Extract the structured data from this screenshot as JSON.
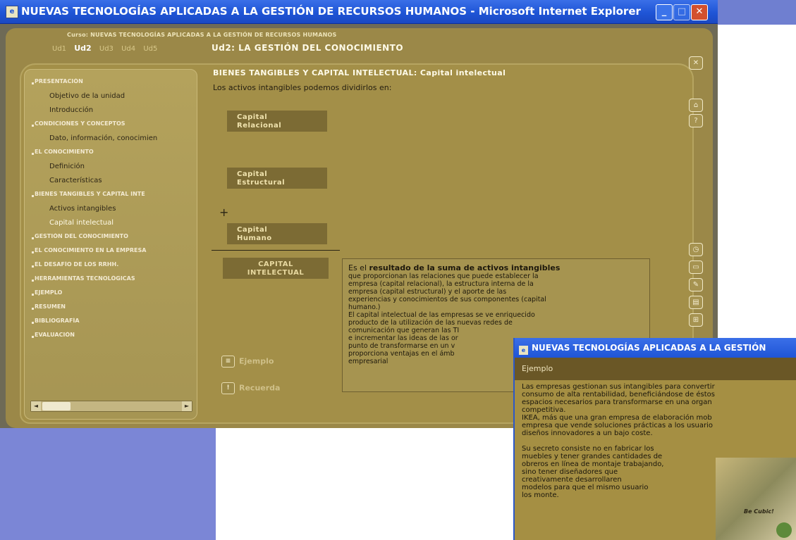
{
  "window": {
    "title": "NUEVAS TECNOLOGÍAS APLICADAS A LA GESTIÓN DE RECURSOS HUMANOS - Microsoft Internet Explorer",
    "min_glyph": "_",
    "max_glyph": "□",
    "close_glyph": "✕"
  },
  "header": {
    "course": "Curso: NUEVAS TECNOLOGÍAS APLICADAS A LA GESTIÓN DE RECURSOS HUMANOS",
    "unit_tabs": [
      "Ud1",
      "Ud2",
      "Ud3",
      "Ud4",
      "Ud5"
    ],
    "unit_title": "Ud2: LA GESTIÓN DEL CONOCIMIENTO"
  },
  "sidebar": {
    "items": [
      {
        "label": "PRESENTACIÓN",
        "kind": "section"
      },
      {
        "label": "Objetivo de la unidad",
        "kind": "sub"
      },
      {
        "label": "Introducción",
        "kind": "sub"
      },
      {
        "label": "CONDICIONES Y CONCEPTOS",
        "kind": "section"
      },
      {
        "label": "Dato, información, conocimien",
        "kind": "sub"
      },
      {
        "label": "EL CONOCIMIENTO",
        "kind": "section"
      },
      {
        "label": "Definición",
        "kind": "sub"
      },
      {
        "label": "Características",
        "kind": "sub"
      },
      {
        "label": "BIENES TANGIBLES Y CAPITAL INTE",
        "kind": "section"
      },
      {
        "label": "Activos intangibles",
        "kind": "sub"
      },
      {
        "label": "Capital intelectual",
        "kind": "sub"
      },
      {
        "label": "GESTIÓN DEL CONOCIMIENTO",
        "kind": "section"
      },
      {
        "label": "EL CONOCIMIENTO EN LA EMPRESA",
        "kind": "section"
      },
      {
        "label": "EL DESAFÍO DE LOS RRHH.",
        "kind": "section"
      },
      {
        "label": "HERRAMIENTAS TECNOLÓGICAS",
        "kind": "section"
      },
      {
        "label": "EJEMPLO",
        "kind": "section"
      },
      {
        "label": "RESUMEN",
        "kind": "section"
      },
      {
        "label": "BIBLIOGRAFÍA",
        "kind": "section"
      },
      {
        "label": "EVALUACIÓN",
        "kind": "section"
      }
    ],
    "scroll_left": "◄",
    "scroll_right": "►"
  },
  "content": {
    "title": "BIENES TANGIBLES Y CAPITAL INTELECTUAL: Capital intelectual",
    "intro": "Los activos intangibles podemos dividirlos en:",
    "capital_relacional": [
      "Capital",
      "Relacional"
    ],
    "capital_estructural": [
      "Capital",
      "Estructural"
    ],
    "capital_humano": [
      "Capital",
      "Humano"
    ],
    "capital_intelectual": [
      "CAPITAL",
      "INTELECTUAL"
    ],
    "plus": "+",
    "definition_lead_pre": "Es el ",
    "definition_lead_bold": "resultado de la suma de activos intangibles",
    "definition_lines": [
      "que proporcionan las relaciones que puede establecer la",
      "empresa (capital relacional), la estructura interna de la",
      "empresa (capital estructural) y el aporte de las",
      "experiencias y conocimientos de sus componentes (capital",
      "humano.)",
      "El capital intelectual de las empresas se ve enriquecido",
      "producto de la utilización de las nuevas redes de",
      "comunicación que generan las TI",
      "e incrementar las ideas de las or",
      "punto de transformarse en un v",
      "proporciona ventajas en el ámb",
      "empresarial"
    ],
    "ejemplo_label": "Ejemplo",
    "recuerda_label": "Recuerda",
    "ejemplo_icon": "≡",
    "recuerda_icon": "!"
  },
  "rail": {
    "close": "✕",
    "home": "⌂",
    "help": "?",
    "btn_a": "◷",
    "btn_b": "▭",
    "btn_c": "✎",
    "btn_d": "▤",
    "btn_e": "⊞"
  },
  "popup": {
    "title": "NUEVAS TECNOLOGÍAS APLICADAS A LA GESTIÓN",
    "heading": "Ejemplo",
    "lines": [
      "Las empresas gestionan sus intangibles para convertir",
      "consumo de alta rentabilidad, beneficiándose de éstos",
      "espacios necesarios para transformarse en una organ",
      "competitiva.",
      "IKEA, más que una gran empresa de elaboración mob",
      "empresa que vende soluciones prácticas a los usuario",
      "diseños innovadores a un bajo coste."
    ],
    "lines2": [
      "Su secreto consiste no en fabricar los",
      "muebles y tener grandes cantidades de",
      "obreros en línea de montaje trabajando,",
      "sino tener diseñadores que",
      "creativamente desarrollaren",
      "modelos para que el mismo usuario",
      "los monte."
    ],
    "photo_brand": "Be Cubic!"
  }
}
